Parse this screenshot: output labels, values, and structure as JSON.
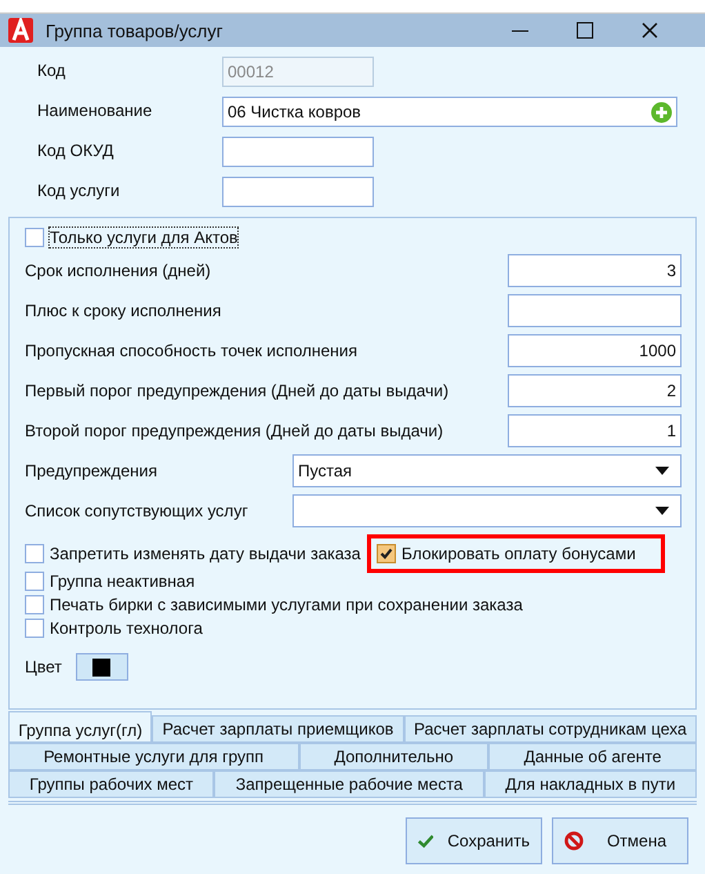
{
  "window": {
    "title": "Группа товаров/услуг"
  },
  "header_fields": [
    {
      "label": "Код",
      "value": "00012",
      "disabled": true,
      "add_button": false
    },
    {
      "label": "Наименование",
      "value": "06 Чистка ковров",
      "disabled": false,
      "add_button": true
    },
    {
      "label": "Код ОКУД",
      "disabled": false,
      "add_button": false
    },
    {
      "label": "Код услуги",
      "disabled": false,
      "add_button": false
    }
  ],
  "acts_only": {
    "label": "Только услуги для Актов",
    "checked": false
  },
  "number_fields": [
    {
      "label": "Срок исполнения (дней)",
      "value": "3"
    },
    {
      "label": "Плюс к сроку исполнения"
    },
    {
      "label": "Пропускная способность точек исполнения",
      "value": "1000"
    },
    {
      "label": "Первый порог предупреждения (Дней до даты выдачи)",
      "value": "2"
    },
    {
      "label": "Второй порог предупреждения (Дней до даты выдачи)",
      "value": "1"
    }
  ],
  "dropdowns": [
    {
      "label": "Предупреждения",
      "value": "Пустая"
    },
    {
      "label": "Список сопутствующих услуг"
    }
  ],
  "options": [
    {
      "label": "Запретить изменять дату выдачи заказа",
      "checked": false,
      "highlighted": false
    },
    {
      "label": "Блокировать оплату бонусами",
      "checked": true,
      "highlighted": true
    },
    {
      "label": "Группа неактивная",
      "checked": false,
      "highlighted": false
    },
    {
      "label": "Печать бирки с зависимыми услугами при сохранении заказа",
      "checked": false,
      "highlighted": false
    },
    {
      "label": "Контроль технолога",
      "checked": false,
      "highlighted": false
    }
  ],
  "color": {
    "label": "Цвет",
    "color": "#000000"
  },
  "tab_rows": [
    [
      {
        "label": "Группа услуг(гл)",
        "selected": true
      },
      {
        "label": "Расчет зарплаты приемщиков",
        "selected": false
      },
      {
        "label": "Расчет зарплаты сотрудникам цеха",
        "selected": false
      }
    ],
    [
      {
        "label": "Ремонтные услуги для групп",
        "selected": false
      },
      {
        "label": "Дополнительно",
        "selected": false
      },
      {
        "label": "Данные об агенте",
        "selected": false
      }
    ],
    [
      {
        "label": "Группы рабочих мест",
        "selected": false
      },
      {
        "label": "Запрещенные рабочие места",
        "selected": false
      },
      {
        "label": "Для накладных в пути",
        "selected": false
      }
    ]
  ],
  "buttons": [
    {
      "label": "Сохранить",
      "kind": "save"
    },
    {
      "label": "Отмена",
      "kind": "cancel"
    }
  ]
}
